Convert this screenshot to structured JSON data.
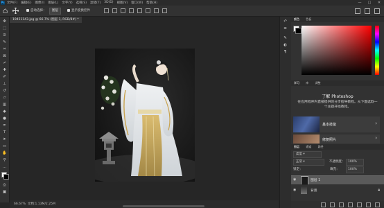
{
  "app": {
    "logo": "Ps"
  },
  "menubar": {
    "items": [
      "文件(F)",
      "编辑(E)",
      "图像(I)",
      "图层(L)",
      "文字(Y)",
      "选择(S)",
      "滤镜(T)",
      "3D(D)",
      "视图(V)",
      "窗口(W)",
      "帮助(H)"
    ],
    "window_controls": [
      "—",
      "□",
      "✕"
    ]
  },
  "options": {
    "auto_select_label": "自动选择：",
    "auto_select_value": "图层",
    "transform_label": "显示变换控件"
  },
  "document": {
    "tab_title": "19451143.jpg @ 66.7% (图层 1, RGB/8#) *",
    "zoom": "66.67%",
    "info": "文档:1.13M/2.25M"
  },
  "panels": {
    "color_tabs": [
      "颜色",
      "色板"
    ],
    "learn_tabs": [
      "学习",
      "库",
      "调整"
    ],
    "learn_title": "了解 Photoshop",
    "learn_desc": "在应用程序内直接提供的分步指导教程。从下面选取一个主题开始教程。",
    "learn_cards": [
      {
        "label": "基本技能"
      },
      {
        "label": "修复照片"
      }
    ],
    "layers_tabs": [
      "图层",
      "通道",
      "路径"
    ],
    "layers_kind": "类型",
    "layers_blend": "正常",
    "layers_opacity": "100%",
    "layers_lock_label": "锁定：",
    "layers_fill": "100%",
    "layers": [
      {
        "name": "图层 1"
      },
      {
        "name": "背景"
      }
    ]
  },
  "colors": {
    "accent": "#31a8ff",
    "ui_dark": "#262626",
    "panel": "#323232"
  }
}
